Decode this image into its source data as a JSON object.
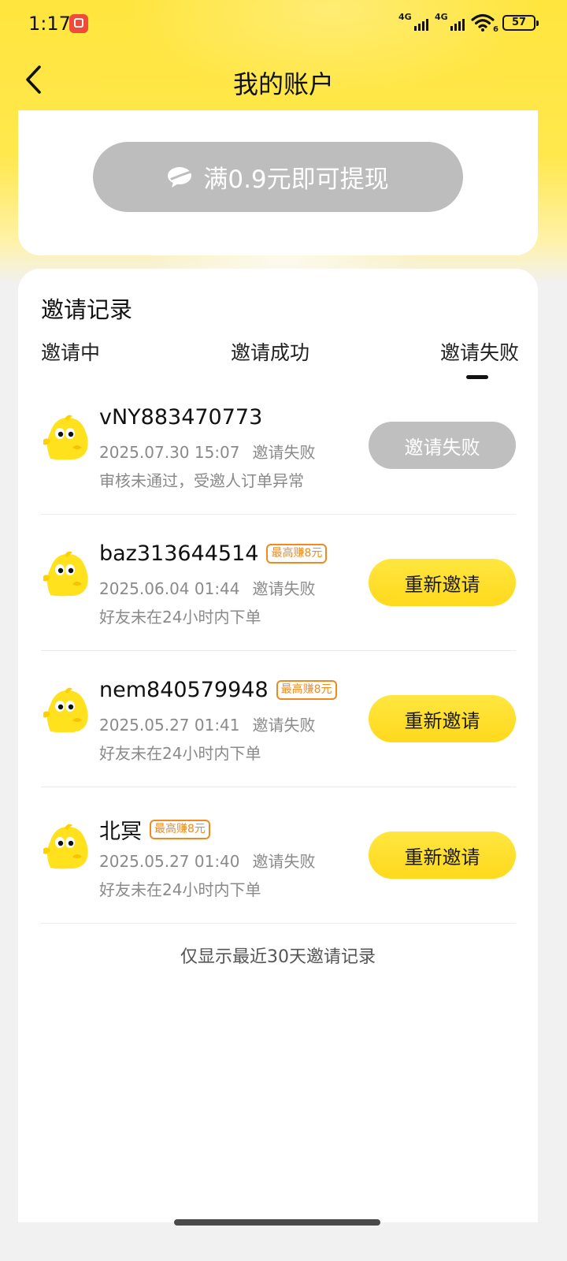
{
  "status_bar": {
    "time": "1:17",
    "network_1": "4G",
    "network_2": "4G",
    "battery": "57",
    "wifi_badge": "6",
    "app_icon": "app-notification-icon"
  },
  "header": {
    "title": "我的账户",
    "back_icon": "chevron-left-icon"
  },
  "withdraw": {
    "label": "满0.9元即可提现",
    "icon": "wechat-icon",
    "color": "#bdbdbd"
  },
  "invite": {
    "title": "邀请记录",
    "tabs": [
      {
        "label": "邀请中",
        "active": false
      },
      {
        "label": "邀请成功",
        "active": false
      },
      {
        "label": "邀请失败",
        "active": true
      }
    ],
    "records": [
      {
        "name": "vNY883470773",
        "badge": "",
        "date": "2025.07.30 15:07",
        "status": "邀请失败",
        "reason": "审核未通过，受邀人订单异常",
        "action": "邀请失败",
        "action_enabled": false
      },
      {
        "name": "baz313644514",
        "badge": "最高赚8元",
        "date": "2025.06.04 01:44",
        "status": "邀请失败",
        "reason": "好友未在24小时内下单",
        "action": "重新邀请",
        "action_enabled": true
      },
      {
        "name": "nem840579948",
        "badge": "最高赚8元",
        "date": "2025.05.27 01:41",
        "status": "邀请失败",
        "reason": "好友未在24小时内下单",
        "action": "重新邀请",
        "action_enabled": true
      },
      {
        "name": "北冥",
        "badge": "最高赚8元",
        "date": "2025.05.27 01:40",
        "status": "邀请失败",
        "reason": "好友未在24小时内下单",
        "action": "重新邀请",
        "action_enabled": true
      }
    ],
    "footer_note": "仅显示最近30天邀请记录"
  },
  "colors": {
    "accent_yellow": "#ffe033",
    "badge_orange": "#f08a1e",
    "disabled_gray": "#bfbfbf"
  }
}
